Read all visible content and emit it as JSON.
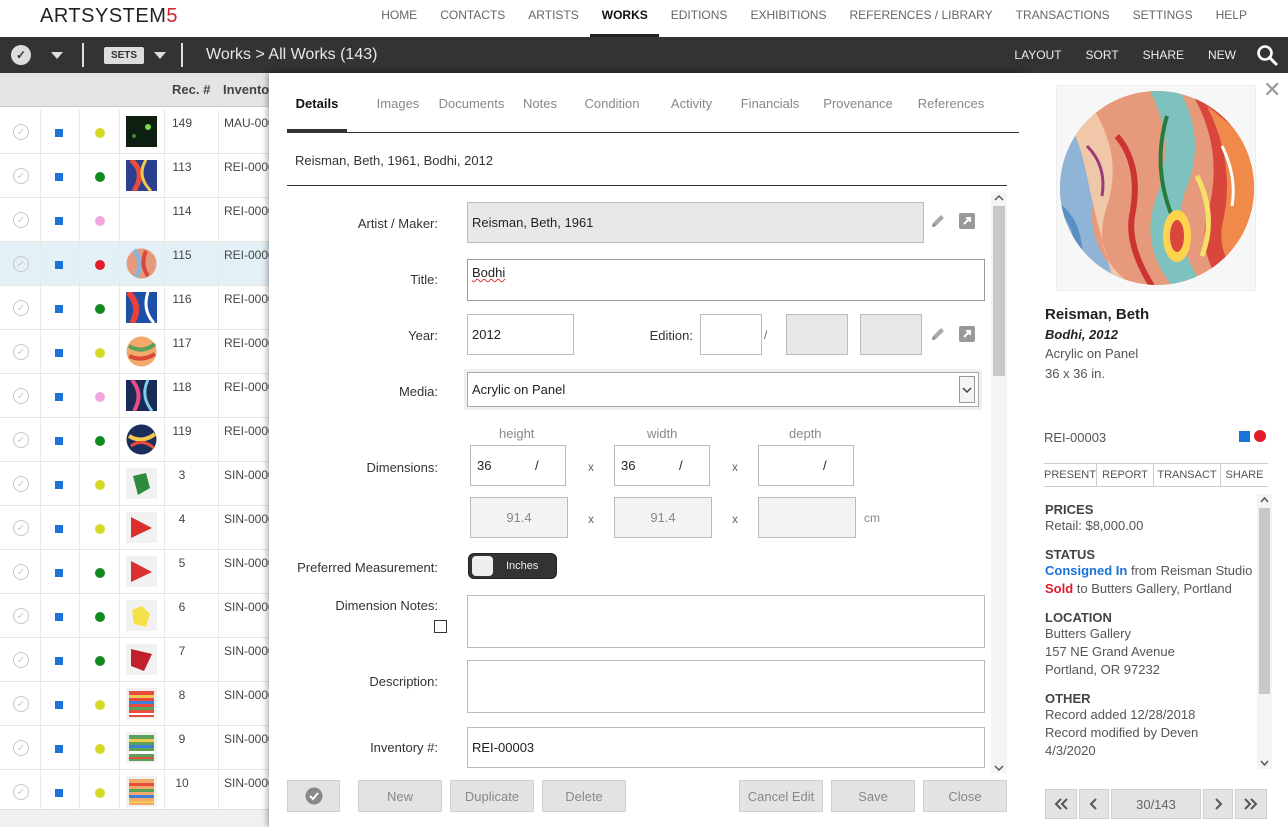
{
  "app": {
    "logo_text": "ARTSYSTEM",
    "logo_suffix": "5"
  },
  "nav": {
    "items": [
      "HOME",
      "CONTACTS",
      "ARTISTS",
      "WORKS",
      "EDITIONS",
      "EXHIBITIONS",
      "REFERENCES / LIBRARY",
      "TRANSACTIONS",
      "SETTINGS",
      "HELP"
    ],
    "active": "WORKS"
  },
  "toolbar": {
    "sets_label": "SETS",
    "breadcrumb": "Works > All Works (143)",
    "layout": "LAYOUT",
    "sort": "SORT",
    "share": "SHARE",
    "new": "NEW"
  },
  "list": {
    "headers": {
      "rec": "Rec. #",
      "inventory": "Invento"
    },
    "rows": [
      {
        "rec": "149",
        "inv": "MAU-000",
        "dot": "#d4d92a",
        "thumb": "dark-green",
        "selected": false
      },
      {
        "rec": "113",
        "inv": "REI-0000",
        "dot": "#138a1e",
        "thumb": "swirl-blue",
        "selected": false
      },
      {
        "rec": "114",
        "inv": "REI-0000",
        "dot": "#f0a8e0",
        "thumb": "none",
        "selected": false
      },
      {
        "rec": "115",
        "inv": "REI-0000",
        "dot": "#e01b2b",
        "thumb": "swirl-round",
        "selected": true
      },
      {
        "rec": "116",
        "inv": "REI-0000",
        "dot": "#138a1e",
        "thumb": "swirl-red",
        "selected": false
      },
      {
        "rec": "117",
        "inv": "REI-0000",
        "dot": "#d4d92a",
        "thumb": "swirl-round2",
        "selected": false
      },
      {
        "rec": "118",
        "inv": "REI-0000",
        "dot": "#f0a8e0",
        "thumb": "swirl-navy",
        "selected": false
      },
      {
        "rec": "119",
        "inv": "REI-0000",
        "dot": "#138a1e",
        "thumb": "swirl-round3",
        "selected": false
      },
      {
        "rec": "3",
        "inv": "SIN-0000",
        "dot": "#d4d92a",
        "thumb": "green-fold",
        "selected": false
      },
      {
        "rec": "4",
        "inv": "SIN-0000",
        "dot": "#d4d92a",
        "thumb": "red-flag",
        "selected": false
      },
      {
        "rec": "5",
        "inv": "SIN-0000",
        "dot": "#138a1e",
        "thumb": "red-flag",
        "selected": false
      },
      {
        "rec": "6",
        "inv": "SIN-0000",
        "dot": "#138a1e",
        "thumb": "yellow-fold",
        "selected": false
      },
      {
        "rec": "7",
        "inv": "SIN-0000",
        "dot": "#138a1e",
        "thumb": "red-flag2",
        "selected": false
      },
      {
        "rec": "8",
        "inv": "SIN-0000",
        "dot": "#d4d92a",
        "thumb": "stripes",
        "selected": false
      },
      {
        "rec": "9",
        "inv": "SIN-0000",
        "dot": "#d4d92a",
        "thumb": "stripes2",
        "selected": false
      },
      {
        "rec": "10",
        "inv": "SIN-0000",
        "dot": "#d4d92a",
        "thumb": "stripes3",
        "selected": false
      }
    ]
  },
  "modal": {
    "tabs": [
      "Details",
      "Images",
      "Documents",
      "Notes",
      "Condition",
      "Activity",
      "Financials",
      "Provenance",
      "References"
    ],
    "active_tab": "Details",
    "summary": "Reisman, Beth, 1961, Bodhi, 2012",
    "labels": {
      "artist": "Artist / Maker:",
      "title": "Title:",
      "year": "Year:",
      "edition": "Edition:",
      "edition_sep": "/",
      "media": "Media:",
      "dimensions": "Dimensions:",
      "height": "height",
      "width": "width",
      "depth": "depth",
      "times": "x",
      "cm": "cm",
      "preferred": "Preferred Measurement:",
      "dim_notes": "Dimension Notes:",
      "description": "Description:",
      "inventory": "Inventory #:"
    },
    "values": {
      "artist": "Reisman, Beth, 1961",
      "title": "Bodhi",
      "year": "2012",
      "edition_num": "",
      "media": "Acrylic on Panel",
      "height_in": "36",
      "width_in": "36",
      "depth_in": "",
      "frac_sep": "/",
      "height_cm": "91.4",
      "width_cm": "91.4",
      "depth_cm": "",
      "preferred": "Inches",
      "dim_notes": "",
      "description": "",
      "inventory": "REI-00003"
    },
    "footer": {
      "new": "New",
      "duplicate": "Duplicate",
      "delete": "Delete",
      "cancel": "Cancel Edit",
      "save": "Save",
      "close": "Close"
    }
  },
  "detail": {
    "artist": "Reisman, Beth",
    "title": "Bodhi, 2012",
    "media": "Acrylic on Panel",
    "dims": "36 x 36 in.",
    "inventory": "REI-00003",
    "actions": [
      "PRESENT",
      "REPORT",
      "TRANSACT",
      "SHARE"
    ],
    "prices_h": "PRICES",
    "retail": "Retail: $8,000.00",
    "status_h": "STATUS",
    "status1_a": "Consigned In",
    "status1_b": " from Reisman Studio",
    "status2_a": "Sold",
    "status2_b": " to Butters Gallery, Portland",
    "location_h": "LOCATION",
    "loc1": "Butters Gallery",
    "loc2": "157 NE Grand Avenue",
    "loc3": "Portland, OR 97232",
    "other_h": "OTHER",
    "other1": "Record added 12/28/2018",
    "other2": "Record modified by Deven",
    "other3": "4/3/2020",
    "pager": "30/143"
  }
}
